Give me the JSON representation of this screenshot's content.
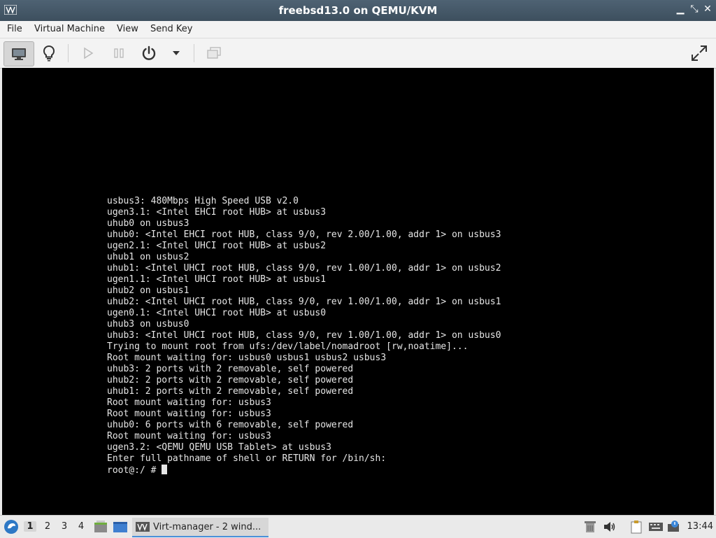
{
  "window": {
    "title": "freebsd13.0 on QEMU/KVM"
  },
  "menubar": {
    "items": [
      "File",
      "Virtual Machine",
      "View",
      "Send Key"
    ]
  },
  "console": {
    "lines": [
      "usbus3: 480Mbps High Speed USB v2.0",
      "ugen3.1: <Intel EHCI root HUB> at usbus3",
      "uhub0 on usbus3",
      "uhub0: <Intel EHCI root HUB, class 9/0, rev 2.00/1.00, addr 1> on usbus3",
      "ugen2.1: <Intel UHCI root HUB> at usbus2",
      "uhub1 on usbus2",
      "uhub1: <Intel UHCI root HUB, class 9/0, rev 1.00/1.00, addr 1> on usbus2",
      "ugen1.1: <Intel UHCI root HUB> at usbus1",
      "uhub2 on usbus1",
      "uhub2: <Intel UHCI root HUB, class 9/0, rev 1.00/1.00, addr 1> on usbus1",
      "ugen0.1: <Intel UHCI root HUB> at usbus0",
      "uhub3 on usbus0",
      "uhub3: <Intel UHCI root HUB, class 9/0, rev 1.00/1.00, addr 1> on usbus0",
      "Trying to mount root from ufs:/dev/label/nomadroot [rw,noatime]...",
      "Root mount waiting for: usbus0 usbus1 usbus2 usbus3",
      "uhub3: 2 ports with 2 removable, self powered",
      "uhub2: 2 ports with 2 removable, self powered",
      "uhub1: 2 ports with 2 removable, self powered",
      "Root mount waiting for: usbus3",
      "Root mount waiting for: usbus3",
      "uhub0: 6 ports with 6 removable, self powered",
      "Root mount waiting for: usbus3",
      "ugen3.2: <QEMU QEMU USB Tablet> at usbus3",
      "Enter full pathname of shell or RETURN for /bin/sh:"
    ],
    "prompt": "root@:/ # "
  },
  "taskbar": {
    "workspaces": [
      "1",
      "2",
      "3",
      "4"
    ],
    "task_label": "Virt-manager - 2 wind...",
    "clock": "13:44"
  }
}
